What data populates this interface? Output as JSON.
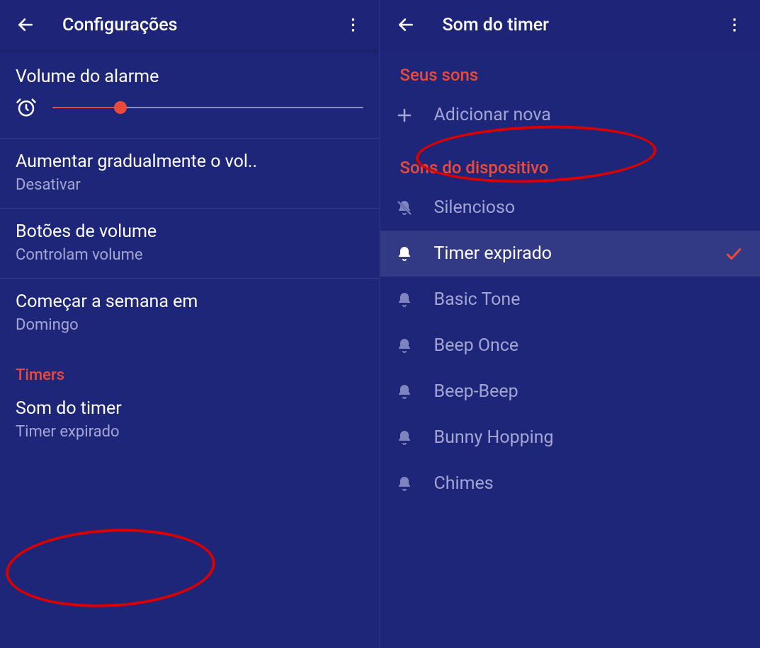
{
  "left": {
    "title": "Configurações",
    "volume": {
      "title": "Volume do alarme",
      "percent": 22
    },
    "gradual": {
      "title": "Aumentar gradualmente o vol..",
      "sub": "Desativar"
    },
    "buttons": {
      "title": "Botões de volume",
      "sub": "Controlam volume"
    },
    "week": {
      "title": "Começar a semana em",
      "sub": "Domingo"
    },
    "timers_header": "Timers",
    "timer_sound": {
      "title": "Som do timer",
      "sub": "Timer expirado"
    }
  },
  "right": {
    "title": "Som do timer",
    "your_sounds_header": "Seus sons",
    "add_new": "Adicionar nova",
    "device_sounds_header": "Sons do dispositivo",
    "items": {
      "silent": "Silencioso",
      "expired": "Timer expirado",
      "basic": "Basic Tone",
      "beep_once": "Beep Once",
      "beep_beep": "Beep-Beep",
      "bunny": "Bunny Hopping",
      "chimes": "Chimes"
    }
  }
}
